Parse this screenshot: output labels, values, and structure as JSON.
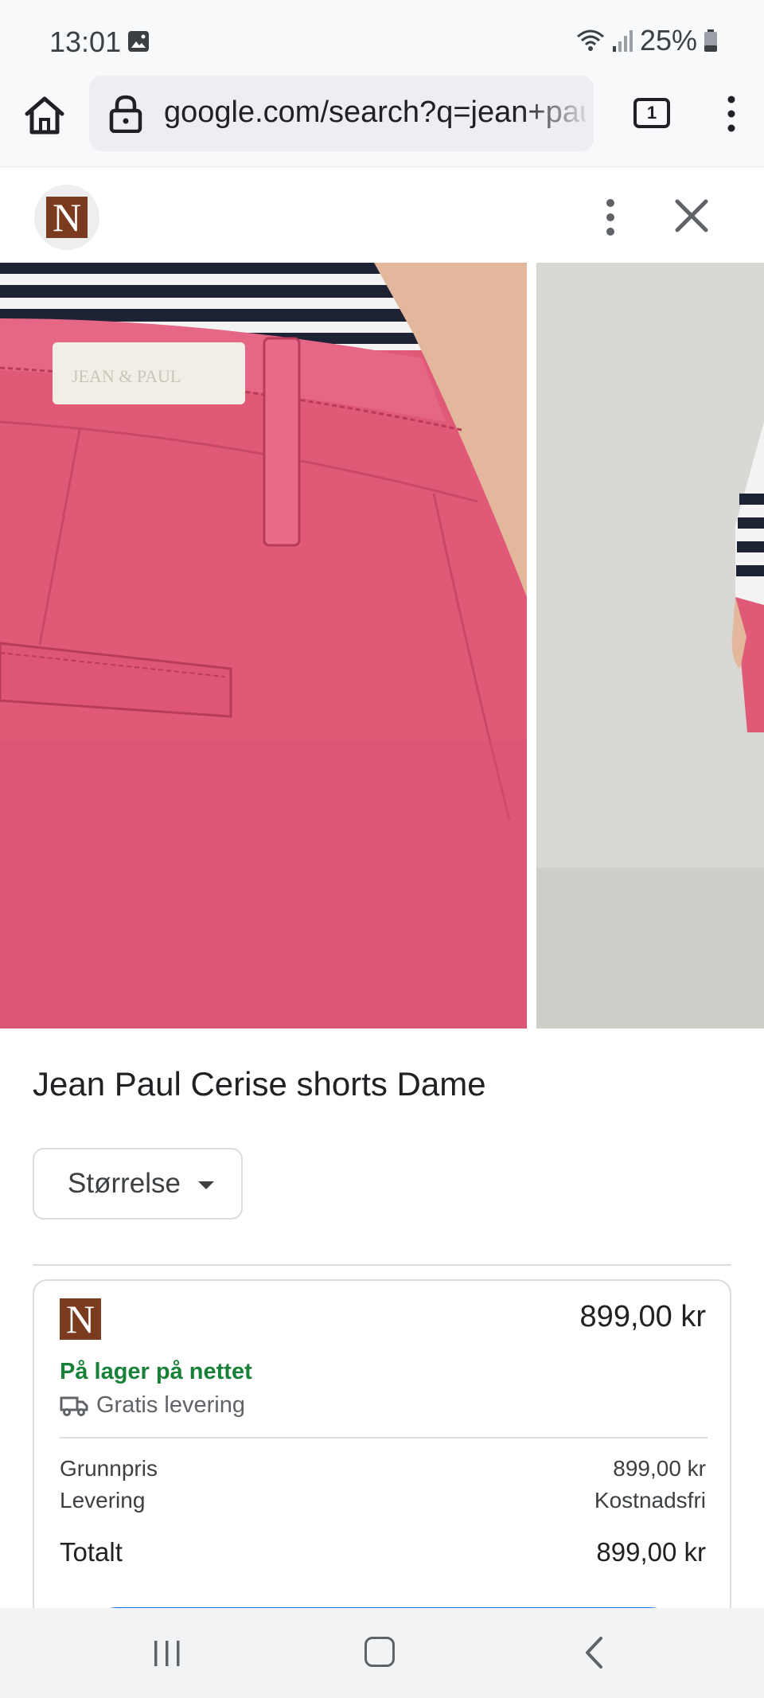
{
  "status_bar": {
    "time": "13:01",
    "battery": "25%",
    "icons": [
      "image-icon",
      "wifi-icon",
      "signal-icon",
      "battery-icon"
    ]
  },
  "browser": {
    "url": "google.com/search?q=jean+paul+cerise+shorts",
    "tab_count": "1",
    "icons": [
      "home-icon",
      "lock-icon",
      "tabs-icon",
      "more-vert-icon"
    ]
  },
  "header": {
    "site_logo_letter": "N",
    "icons": [
      "more-vert-icon",
      "close-icon"
    ]
  },
  "images": {
    "main_label_text": "JEAN PAUL"
  },
  "product": {
    "title": "Jean Paul Cerise shorts Dame",
    "size_button_label": "Størrelse"
  },
  "offer": {
    "logo_letter": "N",
    "price": "899,00 kr",
    "stock_status": "På lager på nettet",
    "delivery_note": "Gratis levering",
    "rows": [
      {
        "label": "Grunnpris",
        "value": "899,00 kr"
      },
      {
        "label": "Levering",
        "value": "Kostnadsfri"
      }
    ],
    "total_label": "Totalt",
    "total_value": "899,00 kr"
  },
  "colors": {
    "stock_green": "#188038",
    "product_pink": "#e05a78",
    "brand_brown": "#7a3b1e",
    "button_blue": "#1a73e8"
  },
  "nav_bar": {
    "icons": [
      "recents-icon",
      "home-icon",
      "back-icon"
    ]
  }
}
